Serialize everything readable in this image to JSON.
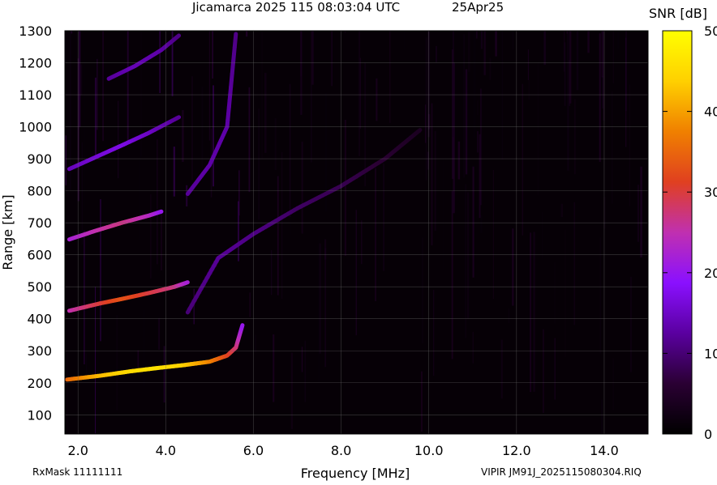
{
  "header": {
    "title": "Jicamarca 2025 115 08:03:04 UTC",
    "date": "25Apr25"
  },
  "footer": {
    "rxmask": "RxMask 11111111",
    "file": "VIPIR  JM91J_2025115080304.RIQ"
  },
  "chart_data": {
    "type": "heatmap",
    "title": "Jicamarca 2025 115 08:03:04 UTC",
    "xlabel": "Frequency [MHz]",
    "ylabel": "Range [km]",
    "colorbar_label": "SNR [dB]",
    "xlim": [
      1.7,
      15.0
    ],
    "ylim": [
      40,
      1300
    ],
    "clim": [
      0,
      50
    ],
    "x_ticks": [
      2.0,
      4.0,
      6.0,
      8.0,
      10.0,
      12.0,
      14.0
    ],
    "x_tick_labels": [
      "2.0",
      "4.0",
      "6.0",
      "8.0",
      "10.0",
      "12.0",
      "14.0"
    ],
    "y_ticks": [
      100,
      200,
      300,
      400,
      500,
      600,
      700,
      800,
      900,
      1000,
      1100,
      1200,
      1300
    ],
    "y_tick_labels": [
      "100",
      "200",
      "300",
      "400",
      "500",
      "600",
      "700",
      "800",
      "900",
      "1000",
      "1100",
      "1200",
      "1300"
    ],
    "colorbar_ticks": [
      0,
      10,
      20,
      30,
      40,
      50
    ],
    "colorbar_tick_labels": [
      "0",
      "10",
      "20",
      "30",
      "40",
      "50"
    ],
    "grid": true,
    "colormap": [
      "#000000",
      "#2a0033",
      "#5a00a0",
      "#8a10ff",
      "#c030b0",
      "#e04020",
      "#f08000",
      "#ffd000",
      "#ffff00"
    ],
    "traces": [
      {
        "x": [
          1.75,
          2.5,
          3.2,
          3.8,
          4.4,
          5.0,
          5.4,
          5.6,
          5.75
        ],
        "y": [
          210,
          222,
          236,
          246,
          255,
          266,
          285,
          310,
          380
        ],
        "snr": [
          35,
          42,
          45,
          46,
          44,
          38,
          32,
          28,
          20
        ]
      },
      {
        "x": [
          1.8,
          2.5,
          3.0,
          3.6,
          4.2,
          4.5
        ],
        "y": [
          425,
          448,
          462,
          480,
          500,
          514
        ],
        "snr": [
          25,
          30,
          33,
          30,
          27,
          22
        ]
      },
      {
        "x": [
          1.8,
          2.4,
          3.0,
          3.6,
          3.9
        ],
        "y": [
          648,
          675,
          700,
          722,
          735
        ],
        "snr": [
          22,
          25,
          27,
          24,
          20
        ]
      },
      {
        "x": [
          1.8,
          2.4,
          3.0,
          3.6,
          4.3
        ],
        "y": [
          868,
          905,
          942,
          980,
          1030
        ],
        "snr": [
          14,
          16,
          17,
          15,
          12
        ]
      },
      {
        "x": [
          2.7,
          3.3,
          3.9,
          4.3
        ],
        "y": [
          1150,
          1190,
          1240,
          1285
        ],
        "snr": [
          12,
          14,
          13,
          11
        ]
      },
      {
        "x": [
          4.5,
          5.0,
          5.4,
          5.6
        ],
        "y": [
          790,
          880,
          1000,
          1290
        ],
        "snr": [
          12,
          13,
          13,
          11
        ]
      },
      {
        "x": [
          4.5,
          5.2,
          6.0,
          7.0,
          8.0,
          9.0,
          9.8
        ],
        "y": [
          420,
          590,
          665,
          745,
          815,
          900,
          990
        ],
        "snr": [
          10,
          12,
          11,
          9,
          8,
          6,
          4
        ]
      }
    ]
  }
}
